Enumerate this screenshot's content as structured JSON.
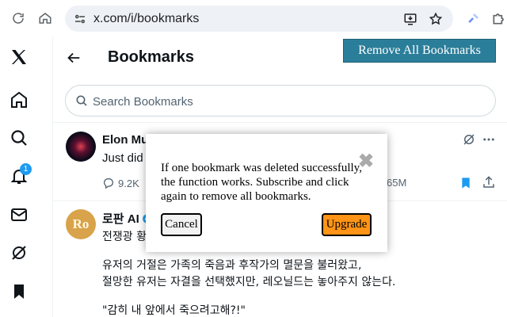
{
  "browser": {
    "url": "x.com/i/bookmarks",
    "icons": [
      "reload-icon",
      "home-icon",
      "site-settings-icon",
      "install-app-icon",
      "star-icon",
      "extension-icon",
      "puzzle-icon"
    ]
  },
  "nav": {
    "items": [
      "x-logo-icon",
      "home-icon",
      "search-icon",
      "notifications-icon",
      "messages-icon",
      "grok-icon",
      "bookmarks-icon"
    ],
    "notifications_badge": "1"
  },
  "header": {
    "title": "Bookmarks",
    "remove_all_label": "Remove All Bookmarks"
  },
  "search": {
    "placeholder": "Search Bookmarks"
  },
  "posts": [
    {
      "author": "Elon Mu",
      "text": "Just did",
      "replies": "9.2K",
      "views": "65M"
    },
    {
      "author": "로판 AI",
      "lines": [
        "전쟁광 황",
        "유저의 거절은 가족의 죽음과 후작가의 멸문을 불러왔고,",
        "절망한 유저는 자결을 선택했지만, 레오닐드는 놓아주지 않는다.",
        "\"감히 내 앞에서 죽으려고해?!\""
      ]
    }
  ],
  "modal": {
    "close_symbol": "✖",
    "message": "If one bookmark was deleted successfully, the function works. Subscribe and click again to remove all bookmarks.",
    "cancel_label": "Cancel",
    "upgrade_label": "Upgrade"
  },
  "colors": {
    "accent": "#1d9bf0",
    "remove_button": "#2b7e9a",
    "upgrade_button": "#ff9416"
  }
}
